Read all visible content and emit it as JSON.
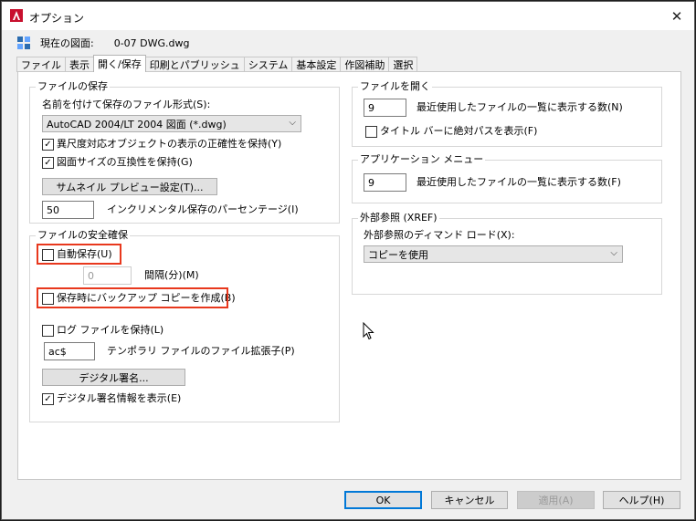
{
  "window": {
    "title": "オプション"
  },
  "drawing": {
    "label": "現在の図面:",
    "name": "0-07 DWG.dwg"
  },
  "tabs": [
    {
      "label": "ファイル"
    },
    {
      "label": "表示"
    },
    {
      "label": "開く/保存"
    },
    {
      "label": "印刷とパブリッシュ"
    },
    {
      "label": "システム"
    },
    {
      "label": "基本設定"
    },
    {
      "label": "作図補助"
    },
    {
      "label": "選択"
    }
  ],
  "file_save": {
    "legend": "ファイルの保存",
    "format_label": "名前を付けて保存のファイル形式(S):",
    "format_value": "AutoCAD 2004/LT 2004 図面 (*.dwg)",
    "annotative_label": "異尺度対応オブジェクトの表示の正確性を保持(Y)",
    "annotative_checked": true,
    "drawing_size_label": "図面サイズの互換性を保持(G)",
    "drawing_size_checked": true,
    "thumbnail_button": "サムネイル プレビュー設定(T)...",
    "incremental_value": "50",
    "incremental_label": "インクリメンタル保存のパーセンテージ(I)"
  },
  "file_safety": {
    "legend": "ファイルの安全確保",
    "autosave_label": "自動保存(U)",
    "autosave_checked": false,
    "interval_value": "0",
    "interval_label": "間隔(分)(M)",
    "backup_label": "保存時にバックアップ コピーを作成(B)",
    "backup_checked": false,
    "log_label": "ログ ファイルを保持(L)",
    "log_checked": false,
    "temp_ext_value": "ac$",
    "temp_ext_label": "テンポラリ ファイルのファイル拡張子(P)",
    "digital_sign_button": "デジタル署名...",
    "show_digital_sign_label": "デジタル署名情報を表示(E)",
    "show_digital_sign_checked": true
  },
  "file_open": {
    "legend": "ファイルを開く",
    "recent_value": "9",
    "recent_label": "最近使用したファイルの一覧に表示する数(N)",
    "full_path_label": "タイトル バーに絶対パスを表示(F)",
    "full_path_checked": false
  },
  "app_menu": {
    "legend": "アプリケーション メニュー",
    "recent_value": "9",
    "recent_label": "最近使用したファイルの一覧に表示する数(F)"
  },
  "xref": {
    "legend": "外部参照 (XREF)",
    "demand_label": "外部参照のディマンド ロード(X):",
    "demand_value": "コピーを使用"
  },
  "footer": {
    "ok": "OK",
    "cancel": "キャンセル",
    "apply": "適用(A)",
    "help": "ヘルプ(H)"
  },
  "colors": {
    "highlight": "#e8381d",
    "default_button_border": "#0078d7",
    "app_icon": "#c8102e"
  }
}
